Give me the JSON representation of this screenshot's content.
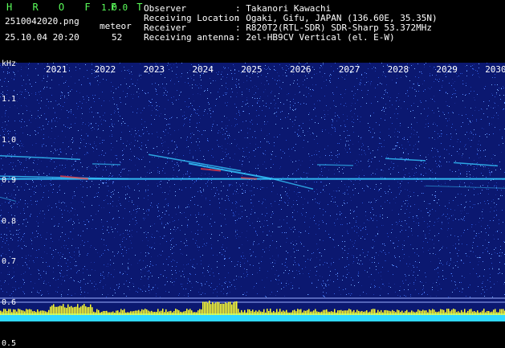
{
  "header": {
    "app_name": "H R O F F T",
    "version": "1.0.0",
    "file_name": "2510042020.png",
    "datetime": "25.10.04 20:20",
    "counter_label": "meteor",
    "counter_value": "52",
    "fields": [
      {
        "label": "Observer",
        "value": ": Takanori Kawachi"
      },
      {
        "label": "Receiving Location",
        "value": ": Ogaki, Gifu, JAPAN (136.60E, 35.35N)"
      },
      {
        "label": "Receiver",
        "value": ": R820T2(RTL-SDR) SDR-Sharp 53.372MHz"
      },
      {
        "label": "Receiving antenna",
        "value": ": 2el-HB9CV Vertical (el. E-W)"
      }
    ]
  },
  "chart_data": {
    "type": "heatmap",
    "ylabel": "kHz",
    "y_ticks": [
      "1.1",
      "1.0",
      "0.9",
      "0.8",
      "0.7",
      "0.6",
      "0.5"
    ],
    "x_ticks": [
      "2021",
      "2022",
      "2023",
      "2024",
      "2025",
      "2026",
      "2027",
      "2028",
      "2029",
      "2030"
    ],
    "ylim": [
      0.58,
      1.2
    ],
    "colors": {
      "background": "#0b1870",
      "signal": "#35c8ff",
      "hot": "#ff4040",
      "level_bar": "#ffff30",
      "level_base": "#30d8ff"
    }
  }
}
